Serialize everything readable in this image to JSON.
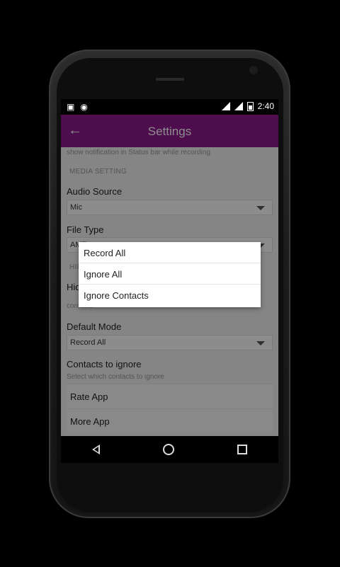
{
  "status_bar": {
    "time": "2:40",
    "left_icons": [
      "image-icon",
      "android-icon"
    ],
    "right_icons": [
      "wifi-icon",
      "signal-icon",
      "battery-icon"
    ]
  },
  "app_bar": {
    "title": "Settings",
    "back_icon": "arrow-left-icon",
    "color": "#8e1a8e"
  },
  "settings": {
    "top_hint": "show notification in Status bar while recording",
    "media_section": "MEDIA SETTING",
    "audio_source": {
      "label": "Audio Source",
      "value": "Mic"
    },
    "file_type": {
      "label": "File Type",
      "value": "AMR"
    },
    "hidden_section": "HIDE",
    "hide_label": "Hide",
    "contacts_hint": "contacts",
    "default_mode": {
      "label": "Default Mode",
      "value": "Record All"
    },
    "contacts_to_ignore": {
      "label": "Contacts to ignore",
      "hint": "Select which contacts to ignore"
    },
    "rate_app": "Rate App",
    "more_app": "More App"
  },
  "dialog": {
    "options": [
      "Record All",
      "Ignore All",
      "Ignore Contacts"
    ]
  },
  "nav_bar": {
    "buttons": [
      "back-icon",
      "home-icon",
      "recent-apps-icon"
    ]
  }
}
